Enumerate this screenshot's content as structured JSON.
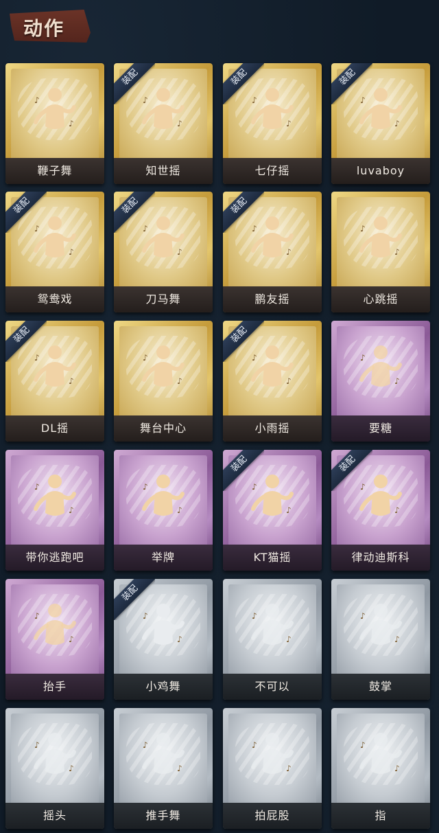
{
  "section": {
    "title": "动作"
  },
  "badge_text": "装配",
  "colors": {
    "gold": "#c59b3a",
    "purple": "#8b5a97",
    "silver": "#8f98a2",
    "badge": "#2d3d57",
    "background": "#101b27"
  },
  "cards": [
    {
      "label": "鞭子舞",
      "tier": "gold",
      "equipped": false,
      "icon": "dancer-heart-icon"
    },
    {
      "label": "知世摇",
      "tier": "gold",
      "equipped": true,
      "icon": "dancer-music-icon"
    },
    {
      "label": "七仔摇",
      "tier": "gold",
      "equipped": true,
      "icon": "dancer-sparkle-icon"
    },
    {
      "label": "luvaboy",
      "tier": "gold",
      "equipped": true,
      "icon": "dancer-arm-icon"
    },
    {
      "label": "鸳鸯戏",
      "tier": "gold",
      "equipped": true,
      "icon": "dancer-music-icon"
    },
    {
      "label": "刀马舞",
      "tier": "gold",
      "equipped": true,
      "icon": "dancer-pose-icon"
    },
    {
      "label": "鹏友摇",
      "tier": "gold",
      "equipped": true,
      "icon": "dancer-wave-icon"
    },
    {
      "label": "心跳摇",
      "tier": "gold",
      "equipped": false,
      "icon": "dancer-arm-up-icon"
    },
    {
      "label": "DL摇",
      "tier": "gold",
      "equipped": true,
      "icon": "dancer-point-up-icon"
    },
    {
      "label": "舞台中心",
      "tier": "gold",
      "equipped": false,
      "icon": "dancer-sparkle-icon"
    },
    {
      "label": "小雨摇",
      "tier": "gold",
      "equipped": true,
      "icon": "dancer-music-icon"
    },
    {
      "label": "要糖",
      "tier": "purple",
      "equipped": false,
      "icon": "figure-reach-icon"
    },
    {
      "label": "带你逃跑吧",
      "tier": "purple",
      "equipped": false,
      "icon": "dancer-point-icon"
    },
    {
      "label": "举牌",
      "tier": "purple",
      "equipped": false,
      "icon": "figure-sign-icon"
    },
    {
      "label": "KT猫摇",
      "tier": "purple",
      "equipped": true,
      "icon": "dancer-music-icon"
    },
    {
      "label": "律动迪斯科",
      "tier": "purple",
      "equipped": true,
      "icon": "dancer-disco-icon"
    },
    {
      "label": "抬手",
      "tier": "purple",
      "equipped": false,
      "icon": "figure-raise-hand-icon"
    },
    {
      "label": "小鸡舞",
      "tier": "silver",
      "equipped": true,
      "icon": "figure-chicken-icon"
    },
    {
      "label": "不可以",
      "tier": "silver",
      "equipped": false,
      "icon": "hand-no-icon"
    },
    {
      "label": "鼓掌",
      "tier": "silver",
      "equipped": false,
      "icon": "hands-clap-icon"
    },
    {
      "label": "摇头",
      "tier": "silver",
      "equipped": false,
      "icon": "figure-shake-head-icon"
    },
    {
      "label": "推手舞",
      "tier": "silver",
      "equipped": false,
      "icon": "figure-push-icon"
    },
    {
      "label": "拍屁股",
      "tier": "silver",
      "equipped": false,
      "icon": "figure-bend-icon"
    },
    {
      "label": "指",
      "tier": "silver",
      "equipped": false,
      "icon": "hand-point-icon"
    }
  ]
}
